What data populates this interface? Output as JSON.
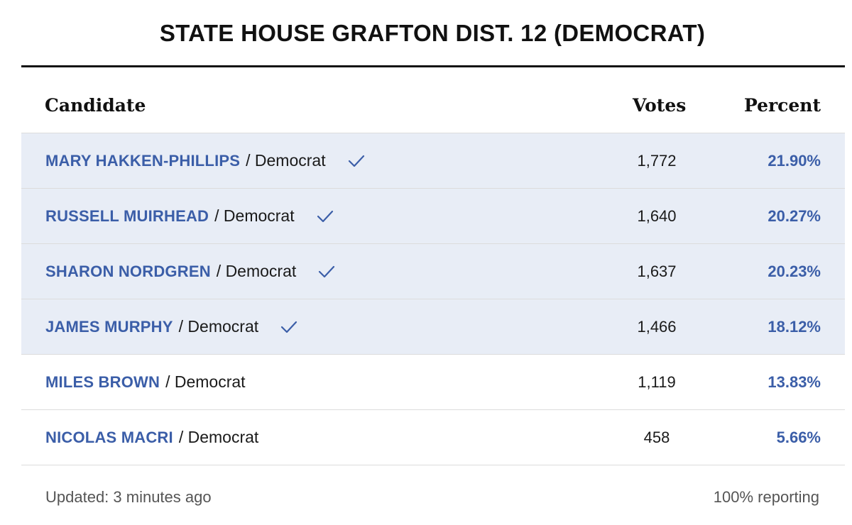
{
  "title": "STATE HOUSE GRAFTON DIST. 12 (DEMOCRAT)",
  "columns": {
    "candidate": "Candidate",
    "votes": "Votes",
    "percent": "Percent"
  },
  "rows": [
    {
      "name": "MARY HAKKEN-PHILLIPS",
      "party": "/ Democrat",
      "votes": "1,772",
      "percent": "21.90%",
      "winner": true
    },
    {
      "name": "RUSSELL MUIRHEAD",
      "party": "/ Democrat",
      "votes": "1,640",
      "percent": "20.27%",
      "winner": true
    },
    {
      "name": "SHARON NORDGREN",
      "party": "/ Democrat",
      "votes": "1,637",
      "percent": "20.23%",
      "winner": true
    },
    {
      "name": "JAMES MURPHY",
      "party": "/ Democrat",
      "votes": "1,466",
      "percent": "18.12%",
      "winner": true
    },
    {
      "name": "MILES BROWN",
      "party": "/ Democrat",
      "votes": "1,119",
      "percent": "13.83%",
      "winner": false
    },
    {
      "name": "NICOLAS MACRI",
      "party": "/ Democrat",
      "votes": "458",
      "percent": "5.66%",
      "winner": false
    }
  ],
  "footer": {
    "updated": "Updated: 3 minutes ago",
    "reporting": "100% reporting"
  },
  "icons": {
    "winner": "checkmark-icon"
  },
  "colors": {
    "accent": "#3b5ea8",
    "winner_row_bg": "#e8edf6",
    "text": "#1a1a1a"
  }
}
